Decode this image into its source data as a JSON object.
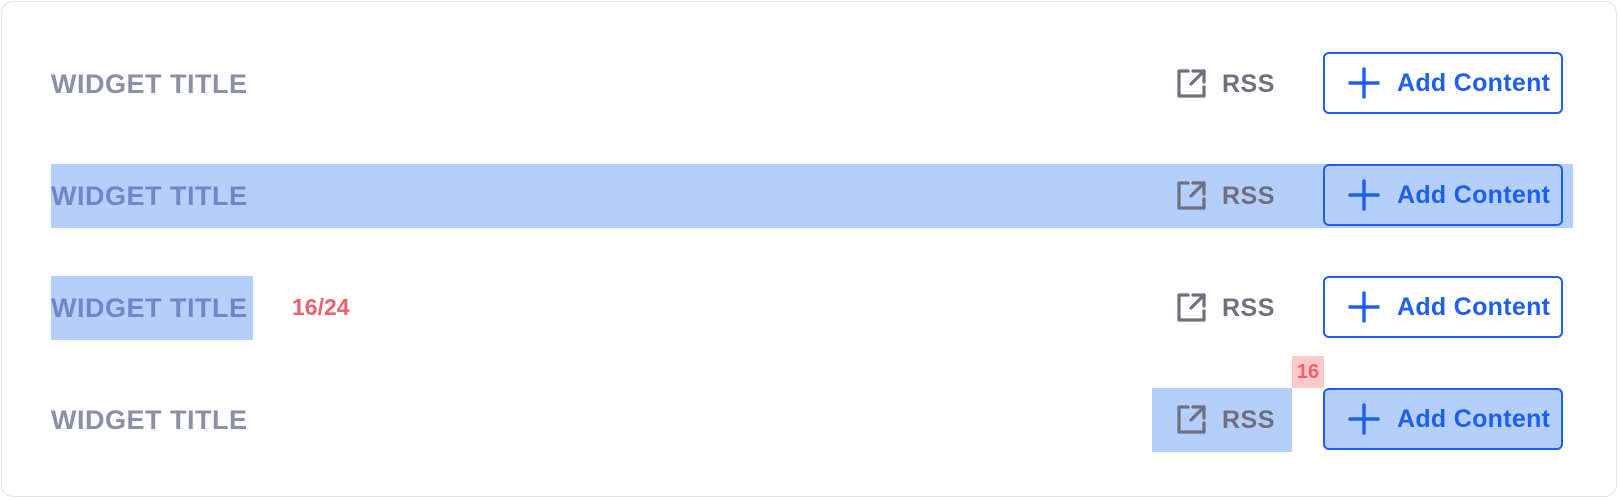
{
  "colors": {
    "accent": "#1d5ff0",
    "highlight": "#b5cffb",
    "measure": "#f0606a",
    "title_text": "#8b8fa8",
    "rss_text": "#6e6f7f"
  },
  "icons": {
    "rss": "external-link-icon",
    "add": "plus-icon"
  },
  "rows": [
    {
      "title": "WIDGET TITLE",
      "rss_label": "RSS",
      "add_label": "Add Content"
    },
    {
      "title": "WIDGET TITLE",
      "rss_label": "RSS",
      "add_label": "Add Content"
    },
    {
      "title": "WIDGET TITLE",
      "rss_label": "RSS",
      "add_label": "Add Content",
      "measure_label": "16/24"
    },
    {
      "title": "WIDGET TITLE",
      "rss_label": "RSS",
      "add_label": "Add Content",
      "gap_label": "16"
    }
  ]
}
